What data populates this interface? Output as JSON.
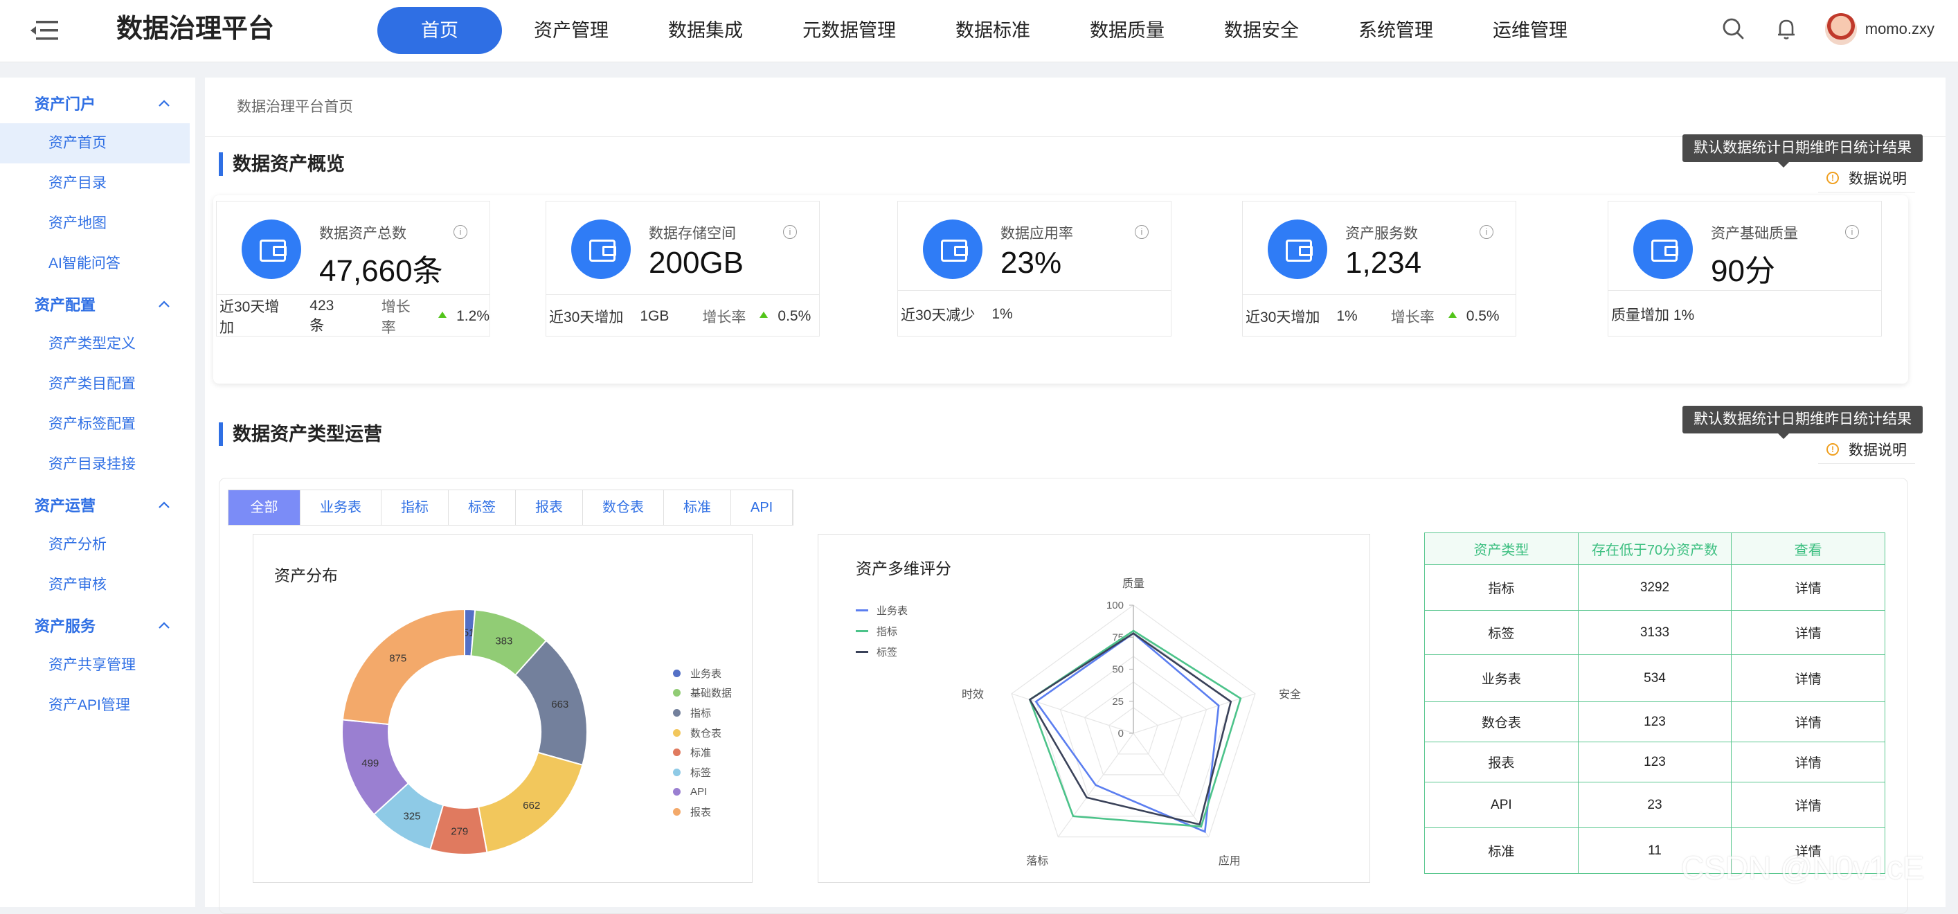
{
  "app": {
    "title": "数据治理平台"
  },
  "nav": [
    {
      "label": "首页",
      "active": true
    },
    {
      "label": "资产管理"
    },
    {
      "label": "数据集成"
    },
    {
      "label": "元数据管理"
    },
    {
      "label": "数据标准"
    },
    {
      "label": "数据质量"
    },
    {
      "label": "数据安全"
    },
    {
      "label": "系统管理"
    },
    {
      "label": "运维管理"
    }
  ],
  "user": {
    "name": "momo.zxy"
  },
  "icons": {
    "menu": "menu-fold-icon",
    "search": "search-icon",
    "bell": "bell-icon",
    "info": "info-icon",
    "warning": "warning-icon",
    "wallet": "wallet-icon"
  },
  "sidebar": {
    "groups": [
      {
        "label": "资产门户",
        "items": [
          {
            "label": "资产首页",
            "active": true
          },
          {
            "label": "资产目录"
          },
          {
            "label": "资产地图"
          },
          {
            "label": "AI智能问答"
          }
        ]
      },
      {
        "label": "资产配置",
        "items": [
          {
            "label": "资产类型定义"
          },
          {
            "label": "资产类目配置"
          },
          {
            "label": "资产标签配置"
          },
          {
            "label": "资产目录挂接"
          }
        ]
      },
      {
        "label": "资产运营",
        "items": [
          {
            "label": "资产分析"
          },
          {
            "label": "资产审核"
          }
        ]
      },
      {
        "label": "资产服务",
        "items": [
          {
            "label": "资产共享管理"
          },
          {
            "label": "资产API管理"
          }
        ]
      }
    ]
  },
  "breadcrumb": "数据治理平台首页",
  "overview": {
    "title": "数据资产概览",
    "tooltip": "默认数据统计日期维昨日统计结果",
    "note": "数据说明",
    "cards": [
      {
        "label": "数据资产总数",
        "value": "47,660条",
        "foot": "近30天增加",
        "foot_val": "423条",
        "rate_label": "增长率",
        "rate": "1.2%"
      },
      {
        "label": "数据存储空间",
        "value": "200GB",
        "foot": "近30天增加",
        "foot_val": "1GB",
        "rate_label": "增长率",
        "rate": "0.5%"
      },
      {
        "label": "数据应用率",
        "value": "23%",
        "foot": "近30天减少",
        "foot_val": "1%"
      },
      {
        "label": "资产服务数",
        "value": "1,234",
        "foot": "近30天增加",
        "foot_val": "1%",
        "rate_label": "增长率",
        "rate": "0.5%"
      },
      {
        "label": "资产基础质量",
        "value": "90分",
        "foot": "质量增加 1%"
      }
    ]
  },
  "operations": {
    "title": "数据资产类型运营",
    "tooltip": "默认数据统计日期维昨日统计结果",
    "note": "数据说明",
    "tabs": [
      {
        "label": "全部",
        "active": true
      },
      {
        "label": "业务表"
      },
      {
        "label": "指标"
      },
      {
        "label": "标签"
      },
      {
        "label": "报表"
      },
      {
        "label": "数仓表"
      },
      {
        "label": "标准"
      },
      {
        "label": "API"
      }
    ],
    "donut_title": "资产分布",
    "radar_title": "资产多维评分",
    "table": {
      "headers": [
        "资产类型",
        "存在低于70分资产数",
        "查看"
      ],
      "rows": [
        [
          "指标",
          "3292",
          "详情"
        ],
        [
          "标签",
          "3133",
          "详情"
        ],
        [
          "业务表",
          "534",
          "详情"
        ],
        [
          "数仓表",
          "123",
          "详情"
        ],
        [
          "报表",
          "123",
          "详情"
        ],
        [
          "API",
          "23",
          "详情"
        ],
        [
          "标准",
          "11",
          "详情"
        ]
      ]
    }
  },
  "chart_data": [
    {
      "type": "pie",
      "subtype": "donut",
      "title": "资产分布",
      "categories": [
        "业务表",
        "基础数据",
        "指标",
        "数仓表",
        "标准",
        "标签",
        "API",
        "报表"
      ],
      "values": [
        51,
        383,
        663,
        662,
        279,
        325,
        499,
        875
      ],
      "colors": [
        "#5470c6",
        "#91cc75",
        "#73809c",
        "#f2c75c",
        "#e07a5f",
        "#8ecae6",
        "#9a7fd1",
        "#f3a96a"
      ],
      "legend": "right"
    },
    {
      "type": "radar",
      "title": "资产多维评分",
      "axes": [
        "质量",
        "安全",
        "应用",
        "落标",
        "时效"
      ],
      "ticks": [
        0,
        25,
        50,
        75,
        100
      ],
      "max": 100,
      "series": [
        {
          "name": "业务表",
          "values": [
            78,
            70,
            95,
            50,
            80
          ],
          "color": "#5b7ef0"
        },
        {
          "name": "指标",
          "values": [
            80,
            88,
            90,
            80,
            85
          ],
          "color": "#4cc38a"
        },
        {
          "name": "标签",
          "values": [
            78,
            80,
            88,
            62,
            85
          ],
          "color": "#3a4259"
        }
      ],
      "legend": "top-left"
    }
  ],
  "watermark": "CSDN @N0v1cE"
}
